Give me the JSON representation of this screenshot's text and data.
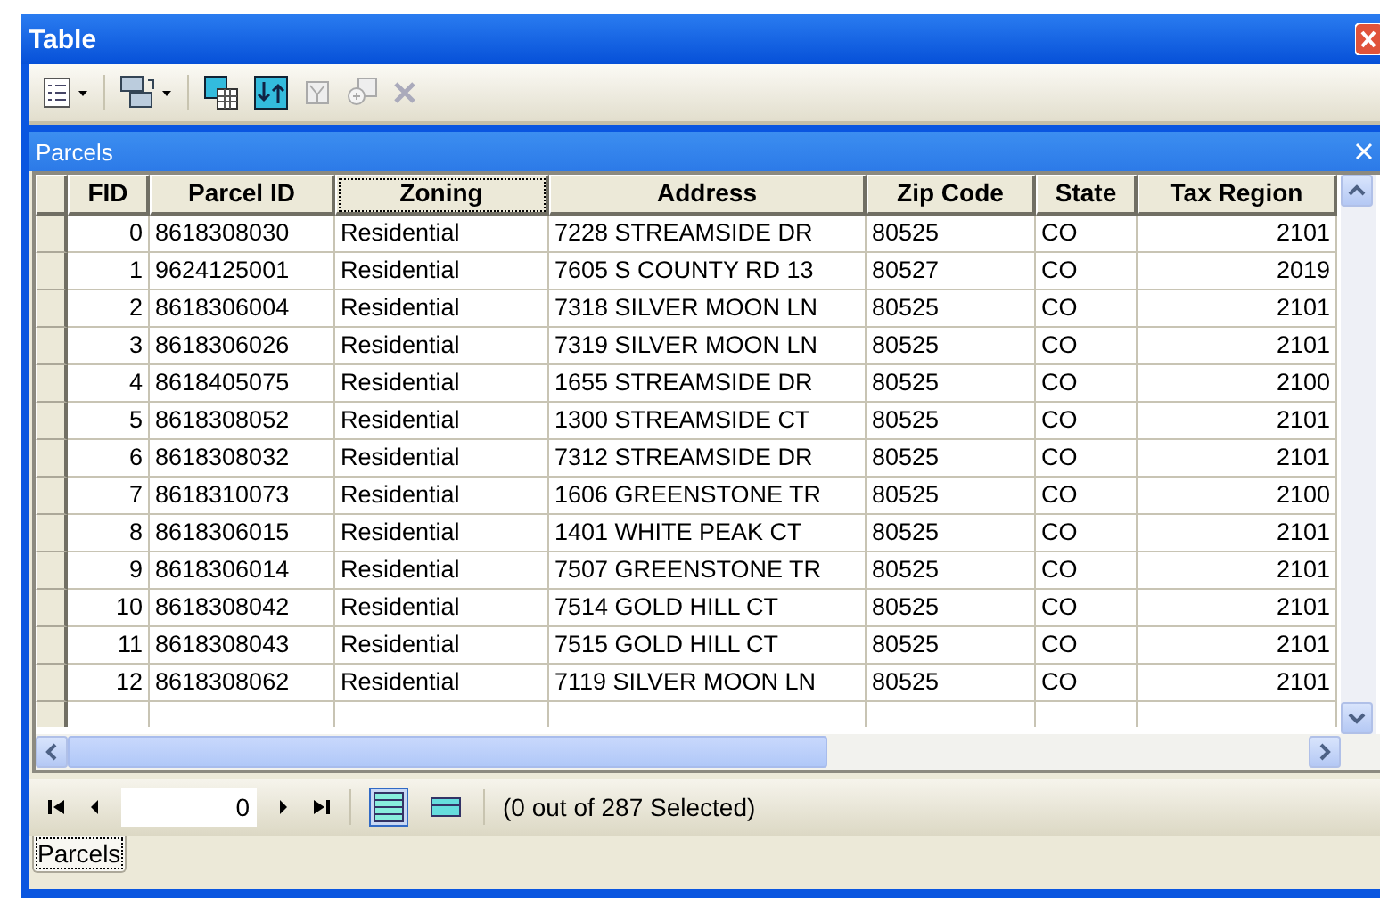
{
  "window": {
    "title": "Table"
  },
  "table_title": "Parcels",
  "table": {
    "columns": [
      {
        "label": "FID",
        "focused": false
      },
      {
        "label": "Parcel ID",
        "focused": false
      },
      {
        "label": "Zoning",
        "focused": true
      },
      {
        "label": "Address",
        "focused": false
      },
      {
        "label": "Zip Code",
        "focused": false
      },
      {
        "label": "State",
        "focused": false
      },
      {
        "label": "Tax Region",
        "focused": false
      }
    ],
    "rows": [
      [
        "0",
        "8618308030",
        "Residential",
        "7228 STREAMSIDE DR",
        "80525",
        "CO",
        "2101"
      ],
      [
        "1",
        "9624125001",
        "Residential",
        "7605 S COUNTY RD 13",
        "80527",
        "CO",
        "2019"
      ],
      [
        "2",
        "8618306004",
        "Residential",
        "7318 SILVER MOON LN",
        "80525",
        "CO",
        "2101"
      ],
      [
        "3",
        "8618306026",
        "Residential",
        "7319 SILVER MOON LN",
        "80525",
        "CO",
        "2101"
      ],
      [
        "4",
        "8618405075",
        "Residential",
        "1655 STREAMSIDE DR",
        "80525",
        "CO",
        "2100"
      ],
      [
        "5",
        "8618308052",
        "Residential",
        "1300 STREAMSIDE CT",
        "80525",
        "CO",
        "2101"
      ],
      [
        "6",
        "8618308032",
        "Residential",
        "7312 STREAMSIDE DR",
        "80525",
        "CO",
        "2101"
      ],
      [
        "7",
        "8618310073",
        "Residential",
        "1606 GREENSTONE TR",
        "80525",
        "CO",
        "2100"
      ],
      [
        "8",
        "8618306015",
        "Residential",
        "1401 WHITE PEAK CT",
        "80525",
        "CO",
        "2101"
      ],
      [
        "9",
        "8618306014",
        "Residential",
        "7507 GREENSTONE TR",
        "80525",
        "CO",
        "2101"
      ],
      [
        "10",
        "8618308042",
        "Residential",
        "7514 GOLD HILL CT",
        "80525",
        "CO",
        "2101"
      ],
      [
        "11",
        "8618308043",
        "Residential",
        "7515 GOLD HILL CT",
        "80525",
        "CO",
        "2101"
      ],
      [
        "12",
        "8618308062",
        "Residential",
        "7119 SILVER MOON LN",
        "80525",
        "CO",
        "2101"
      ]
    ]
  },
  "navigator": {
    "record": "0",
    "selection": "(0 out of 287 Selected)",
    "views": [
      {
        "kind": "all",
        "selected": true
      },
      {
        "kind": "selected",
        "selected": false
      }
    ]
  },
  "tabs": [
    {
      "label": "Parcels",
      "selected": true
    }
  ]
}
